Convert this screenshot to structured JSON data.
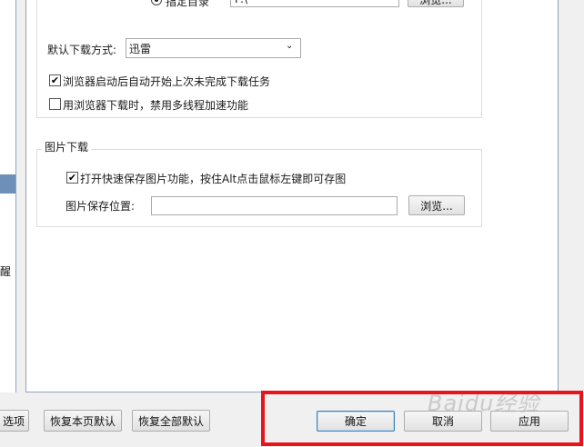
{
  "sidebar": {
    "partial_item_text": "醒"
  },
  "download_group": {
    "radio_label": "指定目录",
    "dir_value": "F:\\",
    "browse_label": "浏览...",
    "method_label": "默认下载方式:",
    "method_value": "迅雷",
    "resume_label": "浏览器启动后自动开始上次未完成下载任务",
    "resume_checked": true,
    "multithread_label": "用浏览器下载时，禁用多线程加速功能",
    "multithread_checked": false
  },
  "image_group": {
    "title": "图片下载",
    "quicksave_label": "打开快速保存图片功能，按住Alt点击鼠标左键即可存图",
    "quicksave_checked": true,
    "path_label": "图片保存位置:",
    "path_value": "",
    "browse_label": "浏览..."
  },
  "footer": {
    "options_label": "选项",
    "restore_page_label": "恢复本页默认",
    "restore_all_label": "恢复全部默认",
    "ok_label": "确定",
    "cancel_label": "取消",
    "apply_label": "应用"
  },
  "checkmark": "✔",
  "watermark": "Baidu经验",
  "colors": {
    "highlight": "#e8141b",
    "selection": "#6d8fb8"
  }
}
